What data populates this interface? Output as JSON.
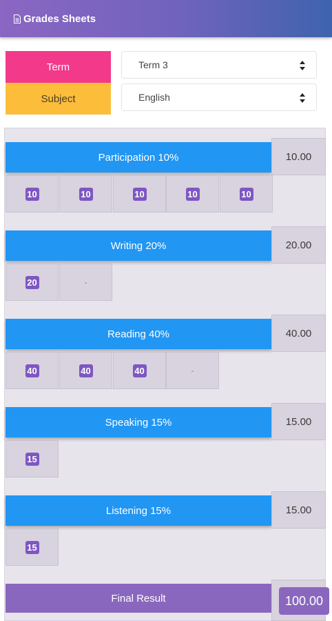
{
  "header": {
    "title": "Grades Sheets",
    "icon": "document-icon"
  },
  "filters": {
    "term_label": "Term",
    "term_value": "Term 3",
    "subject_label": "Subject",
    "subject_value": "English"
  },
  "categories": [
    {
      "title": "Participation 10%",
      "score": "10.00",
      "marks": [
        "10",
        "10",
        "10",
        "10",
        "10"
      ]
    },
    {
      "title": "Writing 20%",
      "score": "20.00",
      "marks": [
        "20",
        "-"
      ]
    },
    {
      "title": "Reading 40%",
      "score": "40.00",
      "marks": [
        "40",
        "40",
        "40",
        "-"
      ]
    },
    {
      "title": "Speaking 15%",
      "score": "15.00",
      "marks": [
        "15"
      ]
    },
    {
      "title": "Listening 15%",
      "score": "15.00",
      "marks": [
        "15"
      ]
    }
  ],
  "final": {
    "label": "Final Result",
    "score": "100.00"
  },
  "colors": {
    "term_label": "#f2398a",
    "subject_label": "#fbbd3a",
    "category_bar": "#2196f3",
    "chip": "#7e57c2",
    "final": "#8a67be"
  }
}
